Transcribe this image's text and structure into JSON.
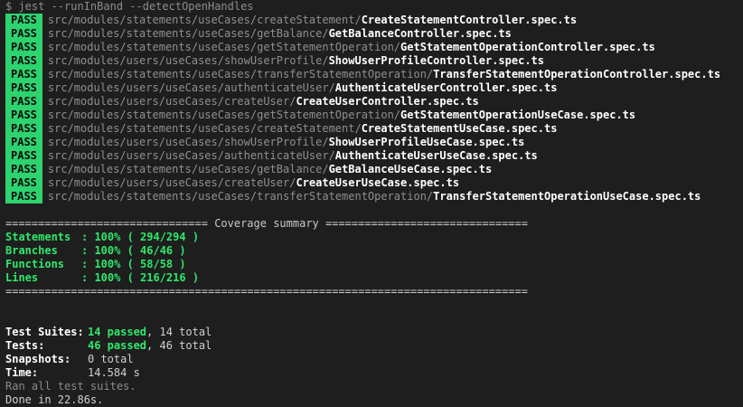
{
  "command": "$ jest --runInBand --detectOpenHandles",
  "badge_label": "PASS",
  "results": [
    {
      "path": "src/modules/statements/useCases/createStatement/",
      "file": "CreateStatementController.spec.ts"
    },
    {
      "path": "src/modules/statements/useCases/getBalance/",
      "file": "GetBalanceController.spec.ts"
    },
    {
      "path": "src/modules/statements/useCases/getStatementOperation/",
      "file": "GetStatementOperationController.spec.ts"
    },
    {
      "path": "src/modules/users/useCases/showUserProfile/",
      "file": "ShowUserProfileController.spec.ts"
    },
    {
      "path": "src/modules/statements/useCases/transferStatementOperation/",
      "file": "TransferStatementOperationController.spec.ts"
    },
    {
      "path": "src/modules/users/useCases/authenticateUser/",
      "file": "AuthenticateUserController.spec.ts"
    },
    {
      "path": "src/modules/users/useCases/createUser/",
      "file": "CreateUserController.spec.ts"
    },
    {
      "path": "src/modules/statements/useCases/getStatementOperation/",
      "file": "GetStatementOperationUseCase.spec.ts"
    },
    {
      "path": "src/modules/statements/useCases/createStatement/",
      "file": "CreateStatementUseCase.spec.ts"
    },
    {
      "path": "src/modules/users/useCases/showUserProfile/",
      "file": "ShowUserProfileUseCase.spec.ts"
    },
    {
      "path": "src/modules/users/useCases/authenticateUser/",
      "file": "AuthenticateUserUseCase.spec.ts"
    },
    {
      "path": "src/modules/statements/useCases/getBalance/",
      "file": "GetBalanceUseCase.spec.ts"
    },
    {
      "path": "src/modules/users/useCases/createUser/",
      "file": "CreateUserUseCase.spec.ts"
    },
    {
      "path": "src/modules/statements/useCases/transferStatementOperation/",
      "file": "TransferStatementOperationUseCase.spec.ts"
    }
  ],
  "coverage": {
    "header": "=============================== Coverage summary ===============================",
    "footer": "================================================================================",
    "rows": [
      {
        "label": "Statements",
        "value": ": 100% ( 294/294 )"
      },
      {
        "label": "Branches",
        "value": ": 100% ( 46/46 )"
      },
      {
        "label": "Functions",
        "value": ": 100% ( 58/58 )"
      },
      {
        "label": "Lines",
        "value": ": 100% ( 216/216 )"
      }
    ]
  },
  "summary": {
    "suites_label": "Test Suites:",
    "suites_passed": "14 passed",
    "suites_total": ", 14 total",
    "tests_label": "Tests:",
    "tests_passed": "46 passed",
    "tests_total": ", 46 total",
    "snapshots_label": "Snapshots:",
    "snapshots_value": "0 total",
    "time_label": "Time:",
    "time_value": "14.584 s",
    "ran_all": "Ran all test suites.",
    "done": "Done in 22.86s."
  },
  "colors": {
    "background": "#1e1e1e",
    "pass_badge": "#2dd36f",
    "green_text": "#2ee86c"
  }
}
